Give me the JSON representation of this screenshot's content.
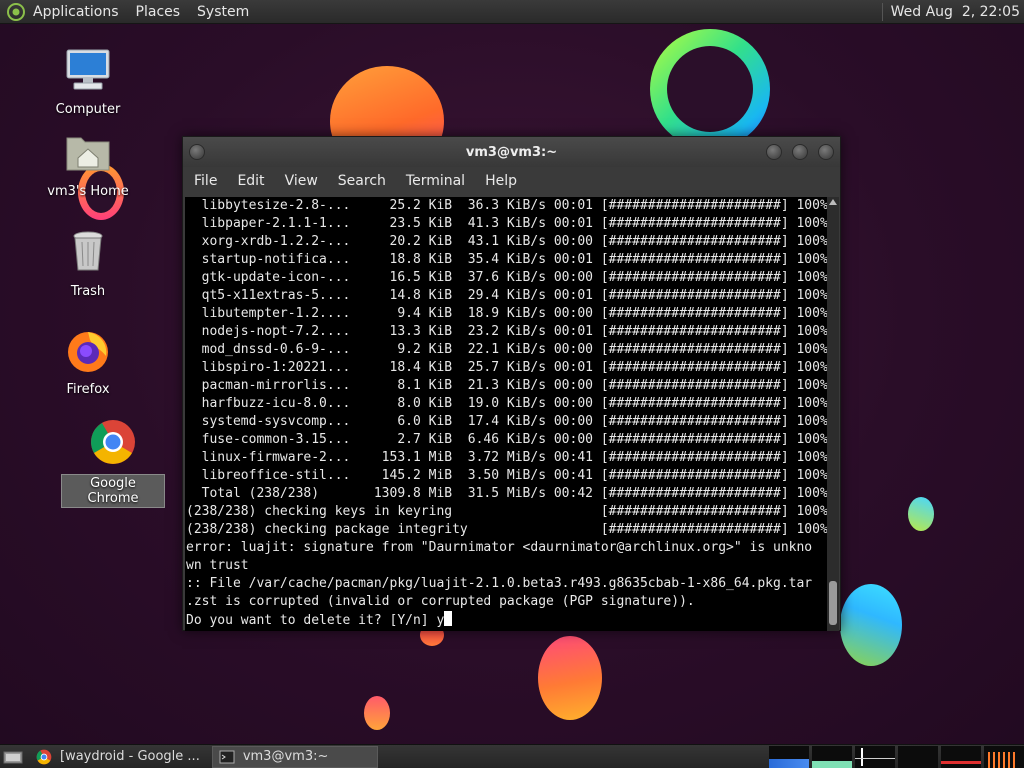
{
  "top_panel": {
    "menus": [
      "Applications",
      "Places",
      "System"
    ],
    "clock": "Wed Aug  2, 22:05"
  },
  "desktop_icons": [
    {
      "label": "Computer",
      "icon": "computer-icon"
    },
    {
      "label": "vm3's Home",
      "icon": "home-folder-icon"
    },
    {
      "label": "Trash",
      "icon": "trash-icon"
    },
    {
      "label": "Firefox",
      "icon": "firefox-icon"
    },
    {
      "label": "Google Chrome",
      "icon": "chrome-icon"
    }
  ],
  "terminal": {
    "title": "vm3@vm3:~",
    "menus": [
      "File",
      "Edit",
      "View",
      "Search",
      "Terminal",
      "Help"
    ],
    "lines": [
      "  libbytesize-2.8-...     25.2 KiB  36.3 KiB/s 00:01 [######################] 100%",
      "  libpaper-2.1.1-1...     23.5 KiB  41.3 KiB/s 00:01 [######################] 100%",
      "  xorg-xrdb-1.2.2-...     20.2 KiB  43.1 KiB/s 00:00 [######################] 100%",
      "  startup-notifica...     18.8 KiB  35.4 KiB/s 00:01 [######################] 100%",
      "  gtk-update-icon-...     16.5 KiB  37.6 KiB/s 00:00 [######################] 100%",
      "  qt5-x11extras-5....     14.8 KiB  29.4 KiB/s 00:01 [######################] 100%",
      "  libutempter-1.2....      9.4 KiB  18.9 KiB/s 00:00 [######################] 100%",
      "  nodejs-nopt-7.2....     13.3 KiB  23.2 KiB/s 00:01 [######################] 100%",
      "  mod_dnssd-0.6-9-...      9.2 KiB  22.1 KiB/s 00:00 [######################] 100%",
      "  libspiro-1:20221...     18.4 KiB  25.7 KiB/s 00:01 [######################] 100%",
      "  pacman-mirrorlis...      8.1 KiB  21.3 KiB/s 00:00 [######################] 100%",
      "  harfbuzz-icu-8.0...      8.0 KiB  19.0 KiB/s 00:00 [######################] 100%",
      "  systemd-sysvcomp...      6.0 KiB  17.4 KiB/s 00:00 [######################] 100%",
      "  fuse-common-3.15...      2.7 KiB  6.46 KiB/s 00:00 [######################] 100%",
      "  linux-firmware-2...    153.1 MiB  3.72 MiB/s 00:41 [######################] 100%",
      "  libreoffice-stil...    145.2 MiB  3.50 MiB/s 00:41 [######################] 100%",
      "  Total (238/238)       1309.8 MiB  31.5 MiB/s 00:42 [######################] 100%",
      "(238/238) checking keys in keyring                   [######################] 100%",
      "(238/238) checking package integrity                 [######################] 100%",
      "error: luajit: signature from \"Daurnimator <daurnimator@archlinux.org>\" is unkno",
      "wn trust",
      ":: File /var/cache/pacman/pkg/luajit-2.1.0.beta3.r493.g8635cbab-1-x86_64.pkg.tar",
      ".zst is corrupted (invalid or corrupted package (PGP signature)).",
      "Do you want to delete it? [Y/n] y"
    ]
  },
  "taskbar": {
    "tasks": [
      {
        "label": "[waydroid - Google ...",
        "icon": "chrome-icon",
        "active": false
      },
      {
        "label": "vm3@vm3:~",
        "icon": "terminal-icon",
        "active": true
      }
    ]
  }
}
